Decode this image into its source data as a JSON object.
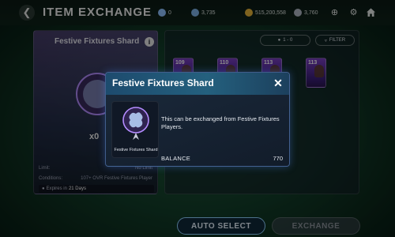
{
  "header": {
    "title": "ITEM EXCHANGE",
    "currencies": [
      {
        "icon": "gem-icon",
        "value": "0",
        "color": "#8fc1ff"
      },
      {
        "icon": "token-icon",
        "value": "3,735",
        "color": "#7fb2e8"
      },
      {
        "icon": "coin-icon",
        "value": "515,200,558",
        "color": "#e7b53a"
      },
      {
        "icon": "fc-points-icon",
        "value": "3,760",
        "color": "#b0b6c4"
      }
    ]
  },
  "left_panel": {
    "title": "Festive Fixtures Shard",
    "count": "x0",
    "limit_label": "Limit:",
    "limit_value": "No Limit",
    "conditions_label": "Conditions:",
    "conditions_value": "107+ OVR Festive Fixtures Player",
    "expires_label": "Expires in",
    "expires_value": "21 Days"
  },
  "right_panel": {
    "sort_label": "1 - 0",
    "filter_label": "FILTER",
    "cards": [
      {
        "rating": "109"
      },
      {
        "rating": "110"
      },
      {
        "rating": "113"
      },
      {
        "rating": "113"
      }
    ]
  },
  "buttons": {
    "auto_select": "AUTO SELECT",
    "exchange": "EXCHANGE"
  },
  "modal": {
    "title": "Festive Fixtures Shard",
    "close": "✕",
    "shard_label": "Festive Fixtures Shard",
    "description": "This can be exchanged from Festive Fixtures Players.",
    "balance_label": "BALANCE",
    "balance_value": "770"
  },
  "colors": {
    "accent_blue": "#8fd0ff",
    "modal_header": "#24607e",
    "card_purple": "#7a3ec2"
  }
}
